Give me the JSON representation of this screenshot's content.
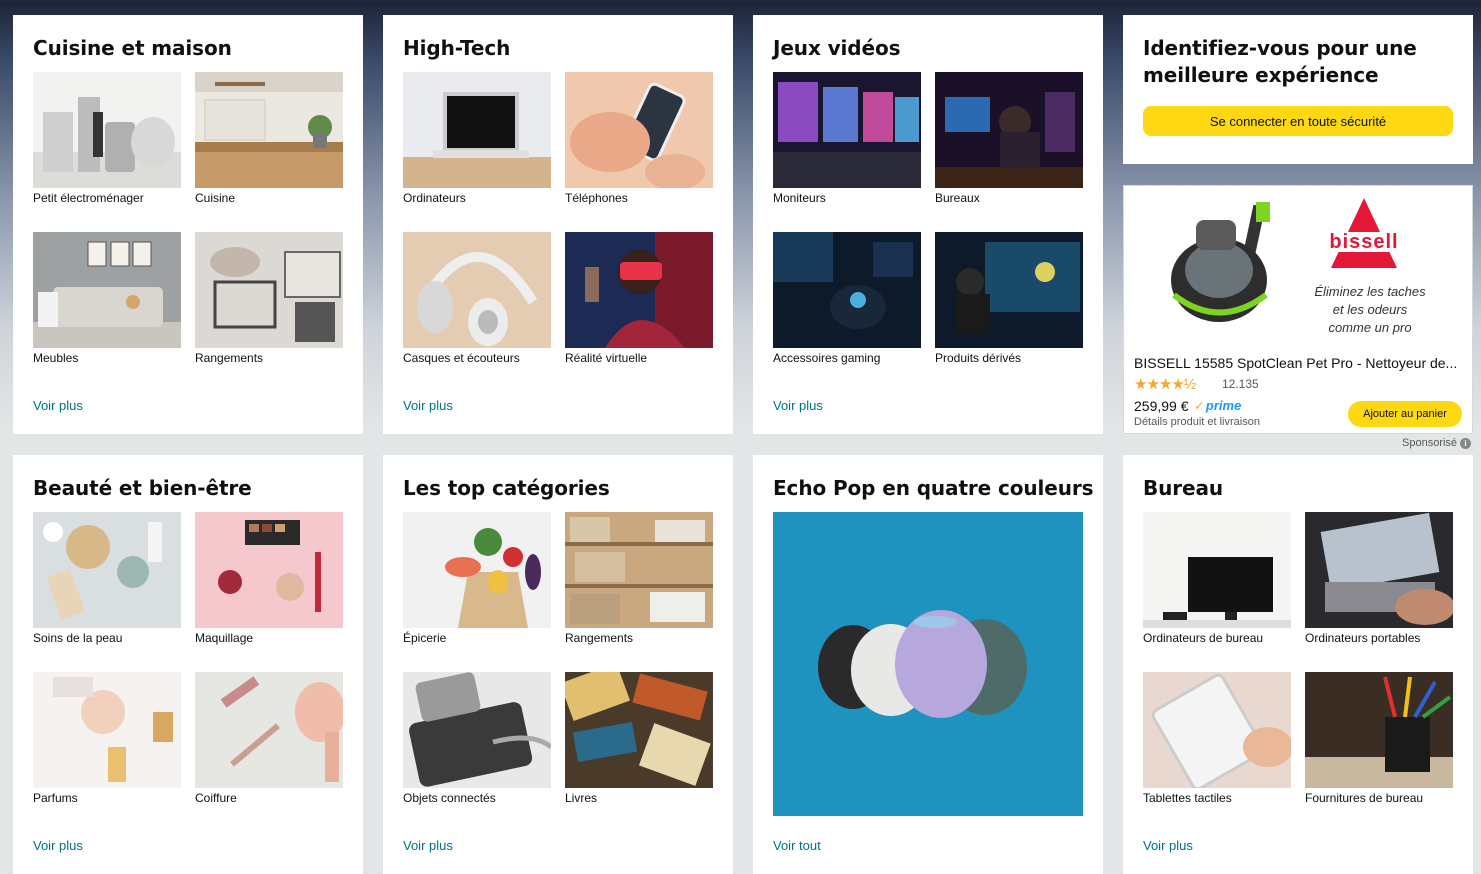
{
  "cards": {
    "cuisine": {
      "title": "Cuisine et maison",
      "items": [
        "Petit électroménager",
        "Cuisine",
        "Meubles",
        "Rangements"
      ],
      "see_more": "Voir plus"
    },
    "hightech": {
      "title": "High-Tech",
      "items": [
        "Ordinateurs",
        "Téléphones",
        "Casques et écouteurs",
        "Réalité virtuelle"
      ],
      "see_more": "Voir plus"
    },
    "jeux": {
      "title": "Jeux vidéos",
      "items": [
        "Moniteurs",
        "Bureaux",
        "Accessoires gaming",
        "Produits dérivés"
      ],
      "see_more": "Voir plus"
    },
    "signin": {
      "title": "Identifiez-vous pour une meilleure expérience",
      "button": "Se connecter en toute sécurité"
    },
    "beaute": {
      "title": "Beauté et bien-être",
      "items": [
        "Soins de la peau",
        "Maquillage",
        "Parfums",
        "Coiffure"
      ],
      "see_more": "Voir plus"
    },
    "top": {
      "title": "Les top catégories",
      "items": [
        "Épicerie",
        "Rangements",
        "Objets connectés",
        "Livres"
      ],
      "see_more": "Voir plus"
    },
    "echo": {
      "title": "Echo Pop en quatre couleurs",
      "see_more": "Voir tout"
    },
    "bureau": {
      "title": "Bureau",
      "items": [
        "Ordinateurs de bureau",
        "Ordinateurs portables",
        "Tablettes tactiles",
        "Fournitures de bureau"
      ],
      "see_more": "Voir plus"
    }
  },
  "ad": {
    "brand": "Bissell",
    "tagline": [
      "Éliminez les taches",
      "et les odeurs",
      "comme un pro"
    ],
    "product_title": "BISSELL 15585 SpotClean Pet Pro - Nettoyeur de...",
    "stars": "★★★★½",
    "rating": 4.5,
    "rating_count": "12.135",
    "price": "259,99 €",
    "prime": "prime",
    "add_to_cart": "Ajouter au panier",
    "details": "Détails produit et livraison",
    "sponsored": "Sponsorisé"
  },
  "colors": {
    "link": "#007185",
    "button_yellow": "#ffd814",
    "star": "#f0a82b",
    "prime_blue": "#1a98ff",
    "echo_bg": "#1e93c0",
    "bissell_red": "#e31837"
  }
}
